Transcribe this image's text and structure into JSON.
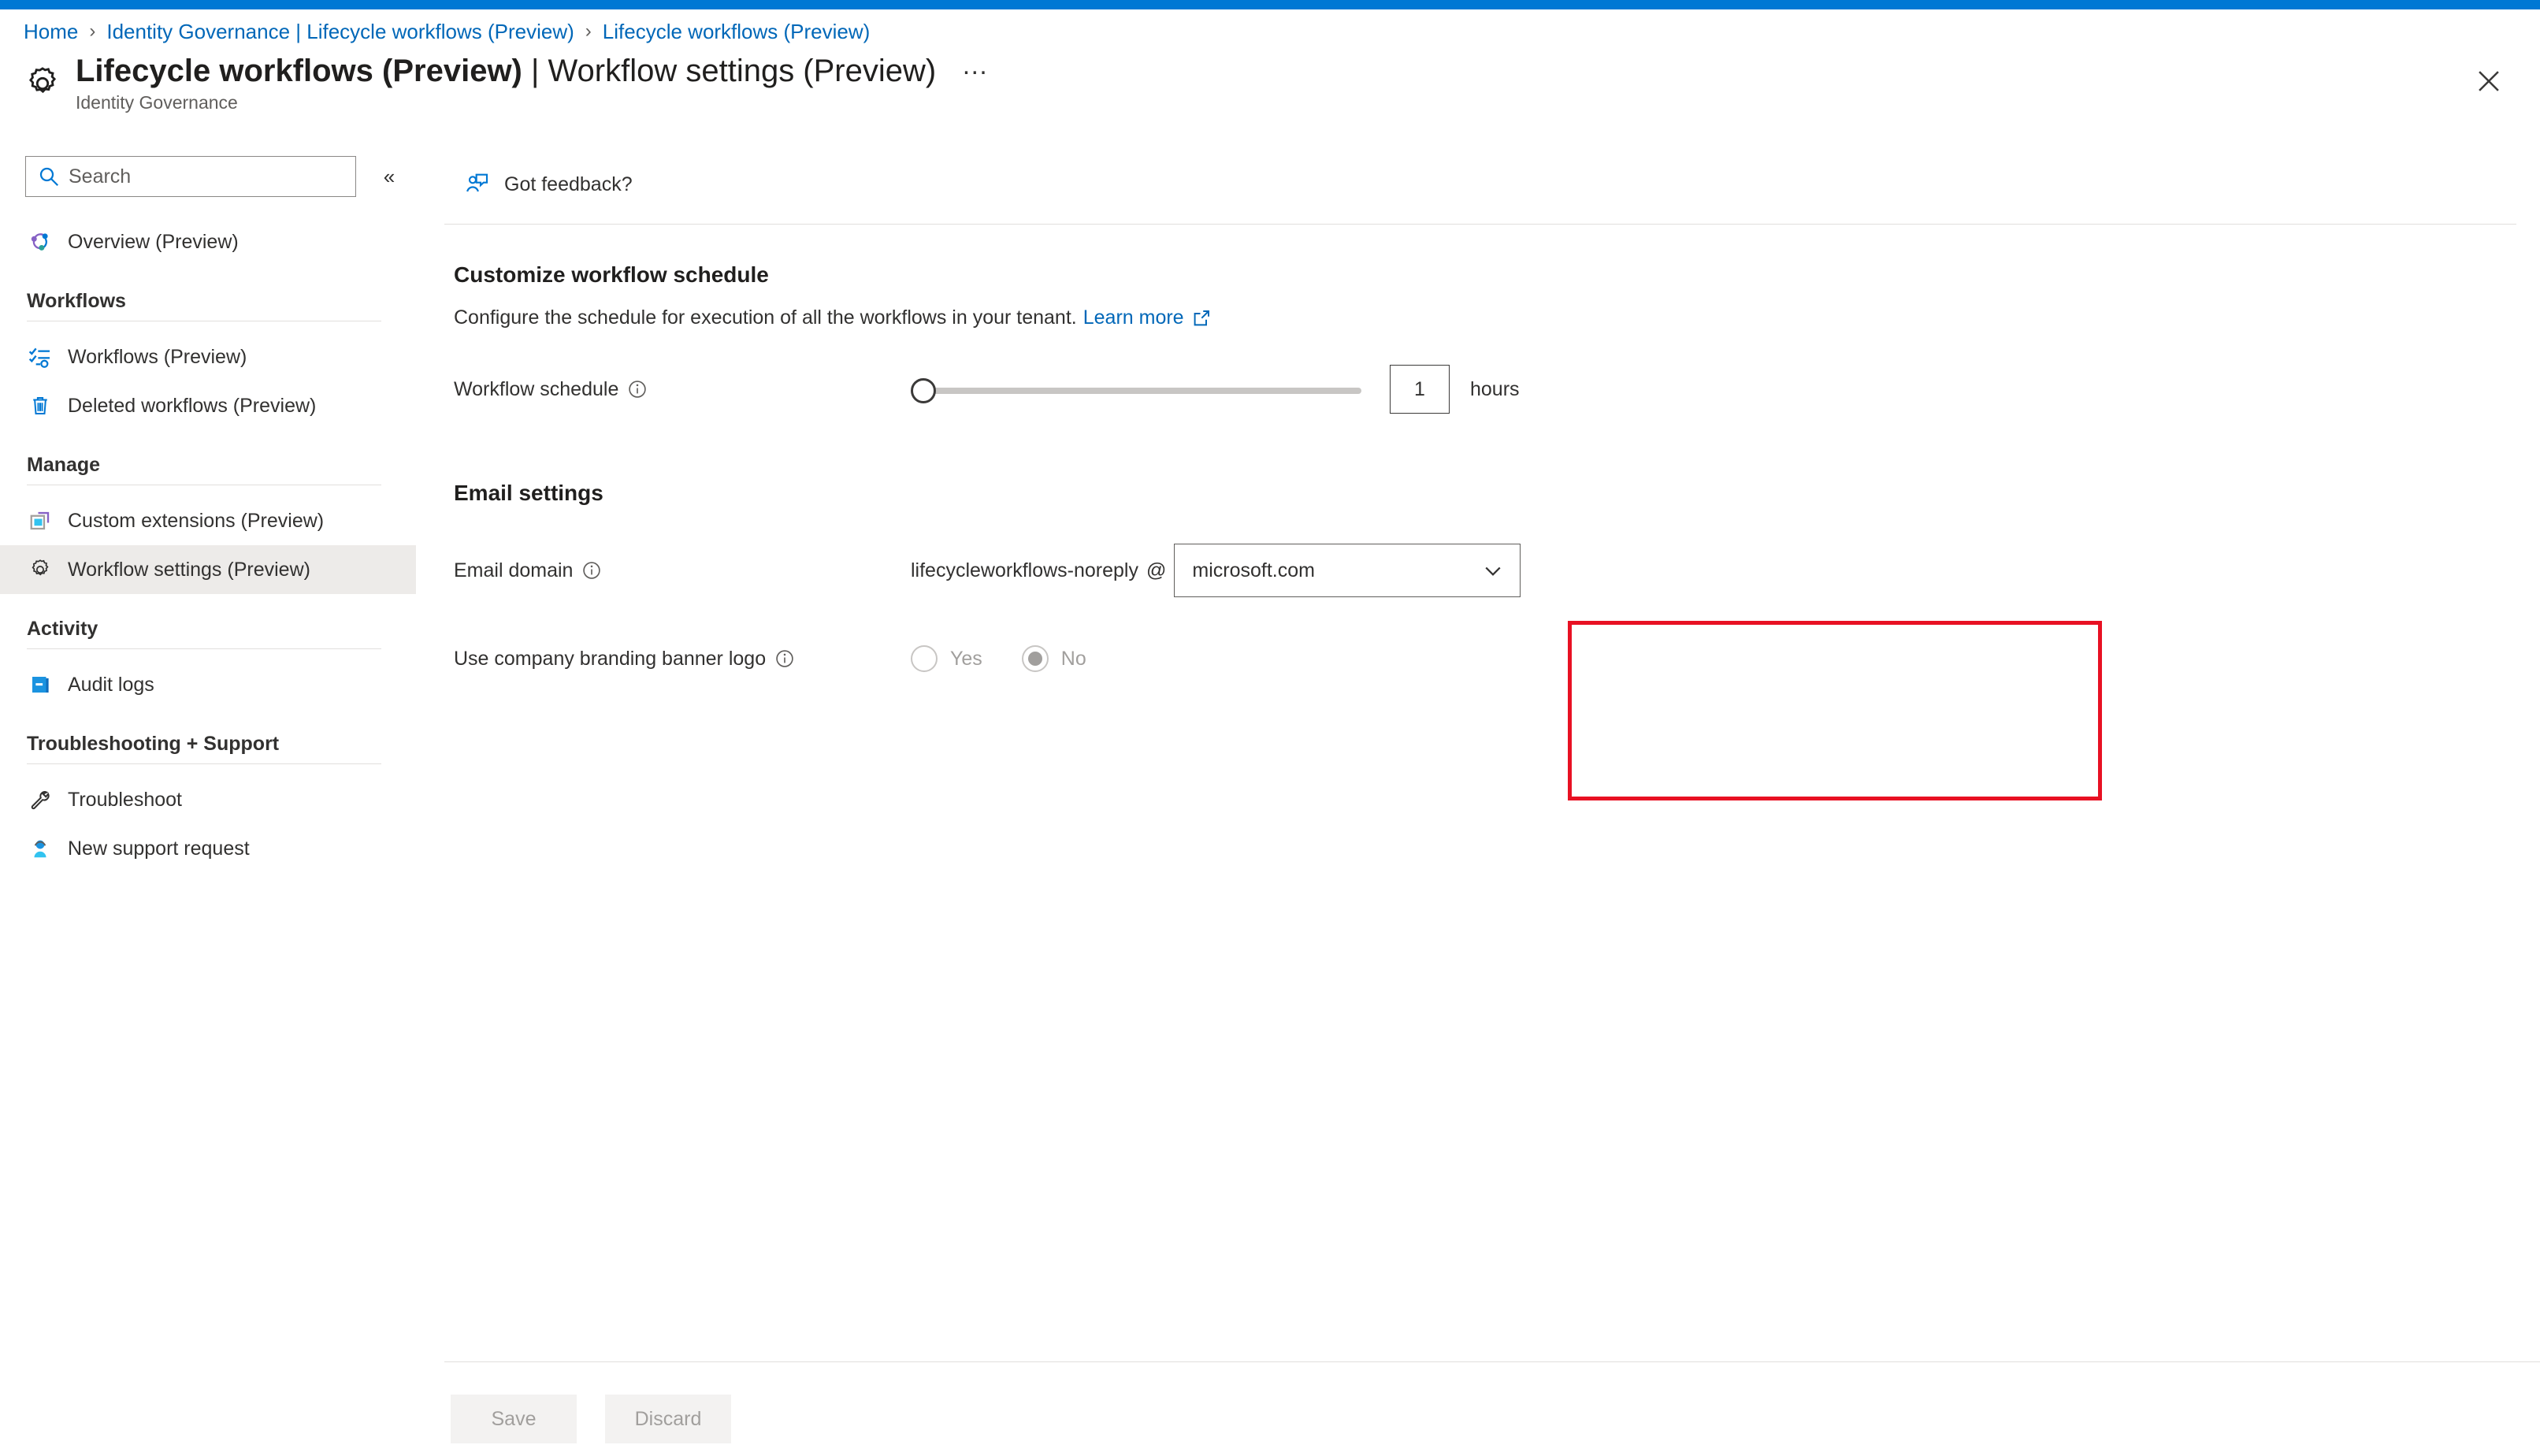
{
  "accent_color": "#0078d4",
  "highlight_color": "#e81123",
  "link_color": "#0067b8",
  "breadcrumb": {
    "items": [
      {
        "label": "Home"
      },
      {
        "label": "Identity Governance | Lifecycle workflows (Preview)"
      },
      {
        "label": "Lifecycle workflows (Preview)"
      }
    ],
    "separator": "›"
  },
  "header": {
    "icon": "gear-icon",
    "title_main": "Lifecycle workflows (Preview)",
    "title_separator": " | ",
    "title_sub": "Workflow settings (Preview)",
    "more_actions": "…",
    "subtitle": "Identity Governance",
    "close_icon": "close-icon"
  },
  "sidebar": {
    "search": {
      "placeholder": "Search",
      "value": "",
      "icon": "search-icon"
    },
    "collapse": {
      "icon": "chevron-double-left-icon",
      "glyph": "«"
    },
    "top_items": [
      {
        "label": "Overview (Preview)",
        "icon": "overview-icon",
        "selected": false
      }
    ],
    "groups": [
      {
        "title": "Workflows",
        "items": [
          {
            "label": "Workflows (Preview)",
            "icon": "workflows-icon",
            "selected": false
          },
          {
            "label": "Deleted workflows (Preview)",
            "icon": "trash-icon",
            "selected": false
          }
        ]
      },
      {
        "title": "Manage",
        "items": [
          {
            "label": "Custom extensions (Preview)",
            "icon": "extensions-icon",
            "selected": false
          },
          {
            "label": "Workflow settings (Preview)",
            "icon": "gear-icon",
            "selected": true
          }
        ]
      },
      {
        "title": "Activity",
        "items": [
          {
            "label": "Audit logs",
            "icon": "audit-log-icon",
            "selected": false
          }
        ]
      },
      {
        "title": "Troubleshooting + Support",
        "items": [
          {
            "label": "Troubleshoot",
            "icon": "wrench-icon",
            "selected": false
          },
          {
            "label": "New support request",
            "icon": "support-person-icon",
            "selected": false
          }
        ]
      }
    ]
  },
  "command_bar": {
    "feedback": {
      "label": "Got feedback?",
      "icon": "feedback-person-icon"
    }
  },
  "main": {
    "schedule_section": {
      "heading": "Customize workflow schedule",
      "description": "Configure the schedule for execution of all the workflows in your tenant.",
      "learn_more": "Learn more",
      "learn_more_icon": "external-link-icon",
      "field": {
        "label": "Workflow schedule",
        "info_icon": "info-icon",
        "slider_value": 1,
        "slider_min": 1,
        "slider_max": 24,
        "number_value": "1",
        "unit": "hours"
      }
    },
    "email_section": {
      "heading": "Email settings",
      "domain_field": {
        "label": "Email domain",
        "info_icon": "info-icon",
        "prefix": "lifecycleworkflows-noreply",
        "at": "@",
        "selected_domain": "microsoft.com",
        "chevron_icon": "chevron-down-icon"
      },
      "branding_field": {
        "label": "Use company branding banner logo",
        "info_icon": "info-icon",
        "options": [
          {
            "label": "Yes",
            "checked": false
          },
          {
            "label": "No",
            "checked": true
          }
        ]
      }
    }
  },
  "footer": {
    "save_label": "Save",
    "discard_label": "Discard"
  }
}
